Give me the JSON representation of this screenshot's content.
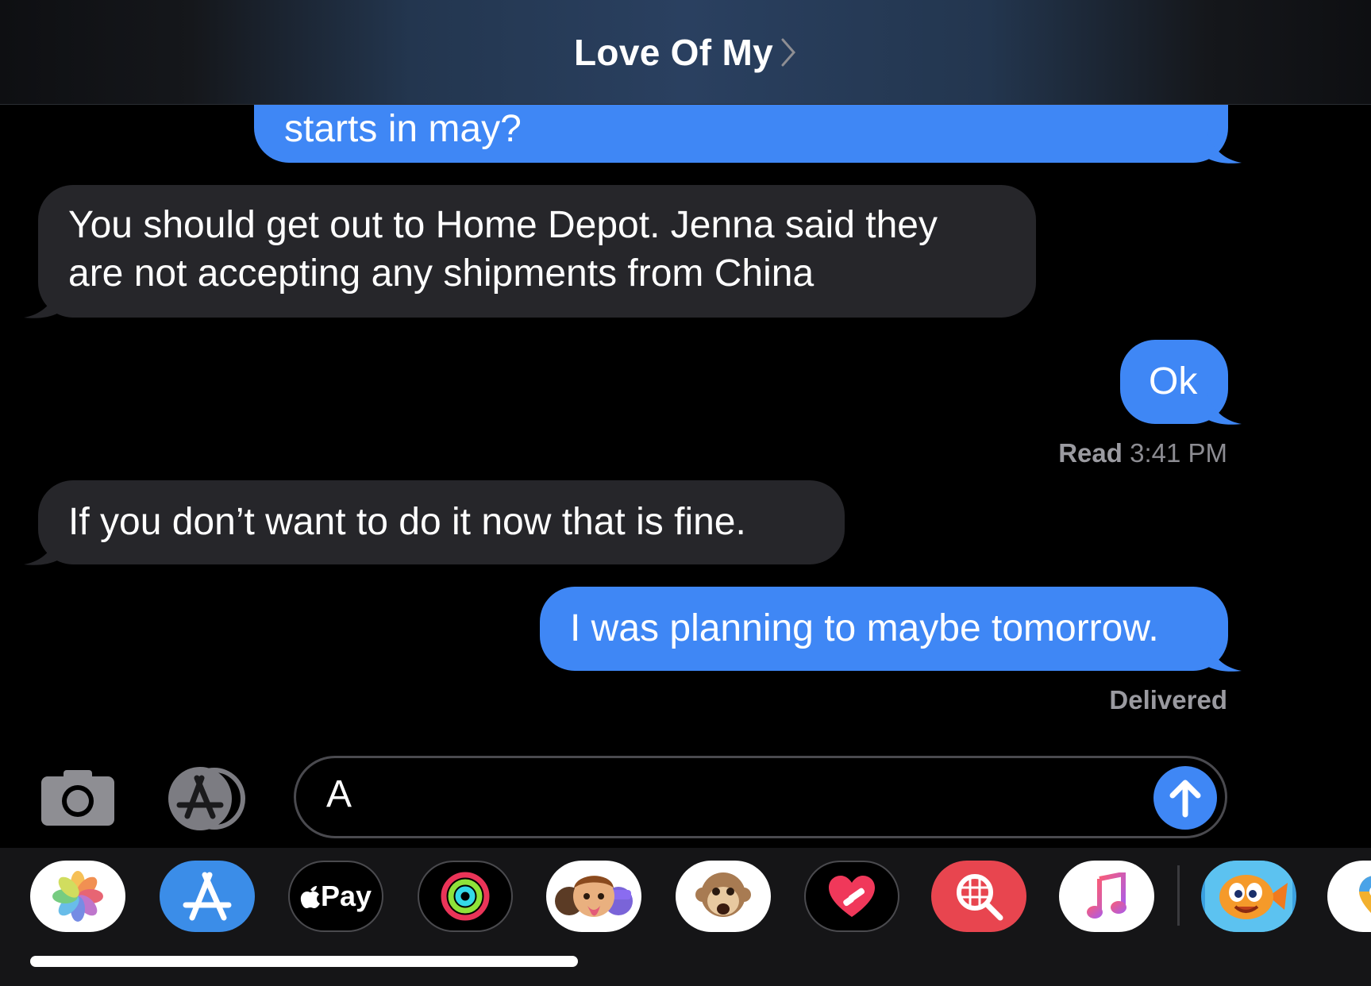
{
  "header": {
    "title": "Love Of My"
  },
  "messages": [
    {
      "direction": "outgoing",
      "text": "starts in may?"
    },
    {
      "direction": "incoming",
      "lines": [
        "You should get out to Home Depot. Jenna said they",
        "are not accepting any shipments from China"
      ]
    },
    {
      "direction": "outgoing",
      "text": "Ok"
    },
    {
      "direction": "incoming",
      "text": "If you don’t want to do it now that is fine."
    },
    {
      "direction": "outgoing",
      "text": "I was planning to maybe tomorrow."
    }
  ],
  "receipts": {
    "read_label": "Read",
    "read_time": "3:41 PM",
    "delivered": "Delivered"
  },
  "composer": {
    "value": "A"
  },
  "drawer": {
    "apps": [
      "photos-app",
      "app-store-app",
      "apple-pay-app",
      "activity-app",
      "memoji-app",
      "animoji-app",
      "digital-touch-app",
      "search-images-app",
      "music-app",
      "fish-game-app",
      "maps-app"
    ],
    "apple_pay_label": "Pay"
  },
  "colors": {
    "outgoing_bubble": "#3f87f5",
    "incoming_bubble": "#26262a",
    "background": "#000000"
  }
}
